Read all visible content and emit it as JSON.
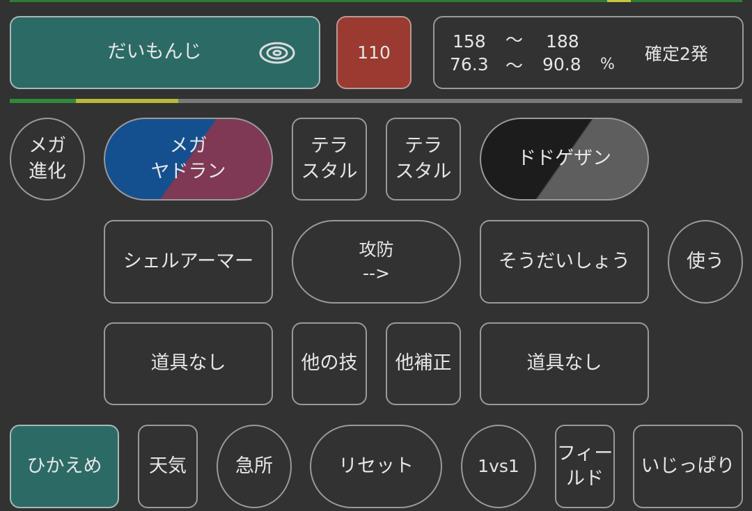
{
  "move": {
    "name": "だいもんじ",
    "power": "110",
    "icon": "fire-ring-icon"
  },
  "damage": {
    "min": "158",
    "tilde1": "〜",
    "max": "188",
    "min_pct": "76.3",
    "tilde2": "〜",
    "max_pct": "90.8",
    "pct_sign": "%",
    "verdict": "確定2発"
  },
  "hp_bar": {
    "green_fraction": 0.09,
    "yellow_fraction": 0.23
  },
  "row1": {
    "mega_evolve": "メガ\n進化",
    "mega_pokemon": "メガ\nヤドラン",
    "terastal_left": "テラ\nスタル",
    "terastal_right": "テラ\nスタル",
    "defender": "ドドゲザン"
  },
  "row2": {
    "ability_left": "シェルアーマー",
    "direction": "攻防\n-->",
    "ability_right": "そうだいしょう",
    "use": "使う"
  },
  "row3": {
    "item_left": "道具なし",
    "other_move": "他の技",
    "other_mod": "他補正",
    "item_right": "道具なし"
  },
  "row4": {
    "nature": "ひかえめ",
    "weather": "天気",
    "critical": "急所",
    "reset": "リセット",
    "mode": "1vs1",
    "field": "フィー\nルド",
    "ability_stubborn": "いじっぱり"
  },
  "colors": {
    "background": "#323232",
    "move_button": "#2c6a66",
    "power_badge": "#9b3a30",
    "nature_button": "#2c6a66",
    "mega_blue": "#14508f",
    "mega_red": "#7f3954",
    "hp_green": "#2e8b3a",
    "hp_yellow": "#b8b83a"
  }
}
